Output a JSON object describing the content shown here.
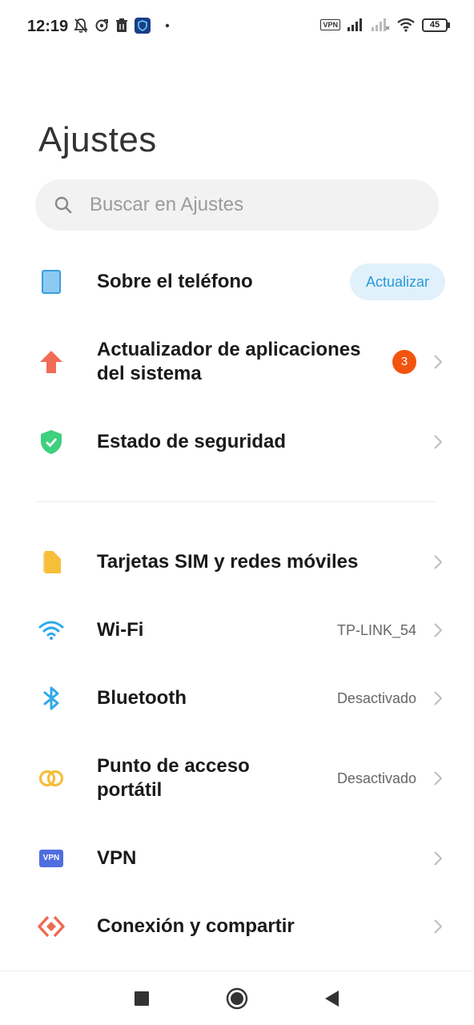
{
  "status_bar": {
    "time": "12:19",
    "vpn_label": "VPN",
    "battery_level": "45"
  },
  "title": "Ajustes",
  "search": {
    "placeholder": "Buscar en Ajustes"
  },
  "items": [
    {
      "label": "Sobre el teléfono",
      "action": "Actualizar",
      "icon": "phone-icon",
      "color": "#4aa8e8"
    },
    {
      "label": "Actualizador de aplicaciones",
      "label2": "del sistema",
      "badge": "3",
      "icon": "arrow-up-icon",
      "color": "#f26b56"
    },
    {
      "label": "Estado de seguridad",
      "icon": "shield-check-icon",
      "color": "#3ecf7f"
    },
    {
      "label": "Tarjetas SIM y redes móviles",
      "icon": "sim-card-icon",
      "color": "#f7be3a"
    },
    {
      "label": "Wi-Fi",
      "value": "TP-LINK_54",
      "icon": "wifi-icon",
      "color": "#2fa8ea"
    },
    {
      "label": "Bluetooth",
      "value": "Desactivado",
      "icon": "bluetooth-icon",
      "color": "#2fa8ea"
    },
    {
      "label": "Punto de acceso",
      "label2": "portátil",
      "value": "Desactivado",
      "icon": "hotspot-icon",
      "color": "#f5be3b"
    },
    {
      "label": "VPN",
      "icon": "vpn-icon",
      "icon_text": "VPN",
      "color": "#4f6ee0"
    },
    {
      "label": "Conexión y compartir",
      "icon": "share-connection-icon",
      "color": "#ee6a50"
    }
  ]
}
